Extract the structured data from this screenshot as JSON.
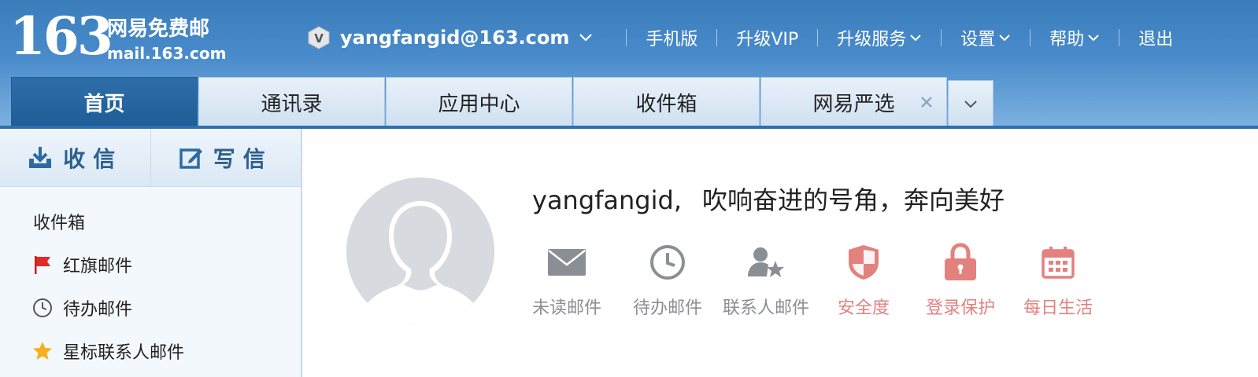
{
  "header": {
    "logo_number": "163",
    "logo_cn": "网易免费邮",
    "logo_domain": "mail.163.com",
    "account": "yangfangid@163.com",
    "nav": [
      "手机版",
      "升级VIP",
      "升级服务",
      "设置",
      "帮助",
      "退出"
    ]
  },
  "tabs": [
    {
      "label": "首页",
      "active": true
    },
    {
      "label": "通讯录"
    },
    {
      "label": "应用中心"
    },
    {
      "label": "收件箱"
    },
    {
      "label": "网易严选",
      "closable": true
    }
  ],
  "sidebar": {
    "receive_label": "收信",
    "compose_label": "写信",
    "folders": [
      "收件箱",
      "红旗邮件",
      "待办邮件",
      "星标联系人邮件"
    ]
  },
  "main": {
    "username": "yangfangid,",
    "slogan": "吹响奋进的号角，奔向美好",
    "quick_links": [
      "未读邮件",
      "待办邮件",
      "联系人邮件",
      "安全度",
      "登录保护",
      "每日生活"
    ]
  },
  "colors": {
    "header_blue": "#3a7dbb",
    "active_tab": "#1f5c98",
    "icon_gray": "#8a8f96",
    "icon_pink": "#e3817f"
  }
}
